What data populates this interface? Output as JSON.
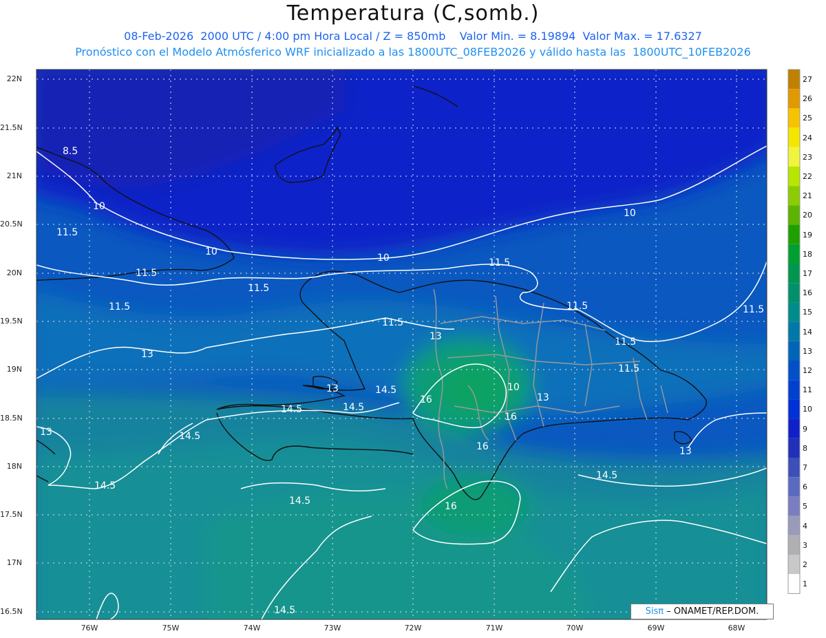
{
  "header": {
    "title": "Temperatura (C,somb.)",
    "line1": "08-Feb-2026  2000 UTC / 4:00 pm Hora Local / Z = 850mb    Valor Min. = 8.19894  Valor Max. = 17.6327",
    "line2": "Pronóstico con el Modelo Atmósferico WRF inicializado a las 1800UTC_08FEB2026 y válido hasta las  1800UTC_10FEB2026"
  },
  "map": {
    "lat_labels": [
      "22N",
      "21.5N",
      "21N",
      "20.5N",
      "20N",
      "19.5N",
      "19N",
      "18.5N",
      "18N",
      "17.5N",
      "17N",
      "16.5N"
    ],
    "lon_labels": [
      "76W",
      "75W",
      "74W",
      "73W",
      "72W",
      "71W",
      "70W",
      "69W",
      "68W"
    ],
    "contour_labels": [
      "8.5",
      "10",
      "10",
      "10",
      "10",
      "11.5",
      "11.5",
      "11.5",
      "11.5",
      "11.5",
      "11.5",
      "11.5",
      "11.5",
      "11.5",
      "11.5",
      "13",
      "13",
      "13",
      "13",
      "13",
      "13",
      "14.5",
      "14.5",
      "14.5",
      "14.5",
      "14.5",
      "14.5",
      "14.5",
      "14.5",
      "16",
      "16",
      "16",
      "16",
      "10"
    ]
  },
  "colorbar": {
    "labels": [
      "27",
      "26",
      "25",
      "24",
      "23",
      "22",
      "21",
      "20",
      "19",
      "18",
      "17",
      "16",
      "15",
      "14",
      "13",
      "12",
      "11",
      "10",
      "9",
      "8",
      "7",
      "6",
      "5",
      "4",
      "3",
      "2",
      "1"
    ],
    "colors": [
      "#c08000",
      "#e09a00",
      "#f5c400",
      "#f5e600",
      "#f0f53c",
      "#b7e600",
      "#8ccc00",
      "#5cb400",
      "#1fa000",
      "#00a030",
      "#009650",
      "#00906a",
      "#008c8a",
      "#0078a8",
      "#0064b8",
      "#0050c8",
      "#0040d0",
      "#0030d8",
      "#1020c8",
      "#2030b8",
      "#3c50b8",
      "#5a6ac0",
      "#7a7ec0",
      "#9a9aba",
      "#b0b0b4",
      "#c8c8c8",
      "#ffffff"
    ]
  },
  "credit": {
    "brand": "Sisπ",
    "text": "– ONAMET/REP.DOM."
  }
}
